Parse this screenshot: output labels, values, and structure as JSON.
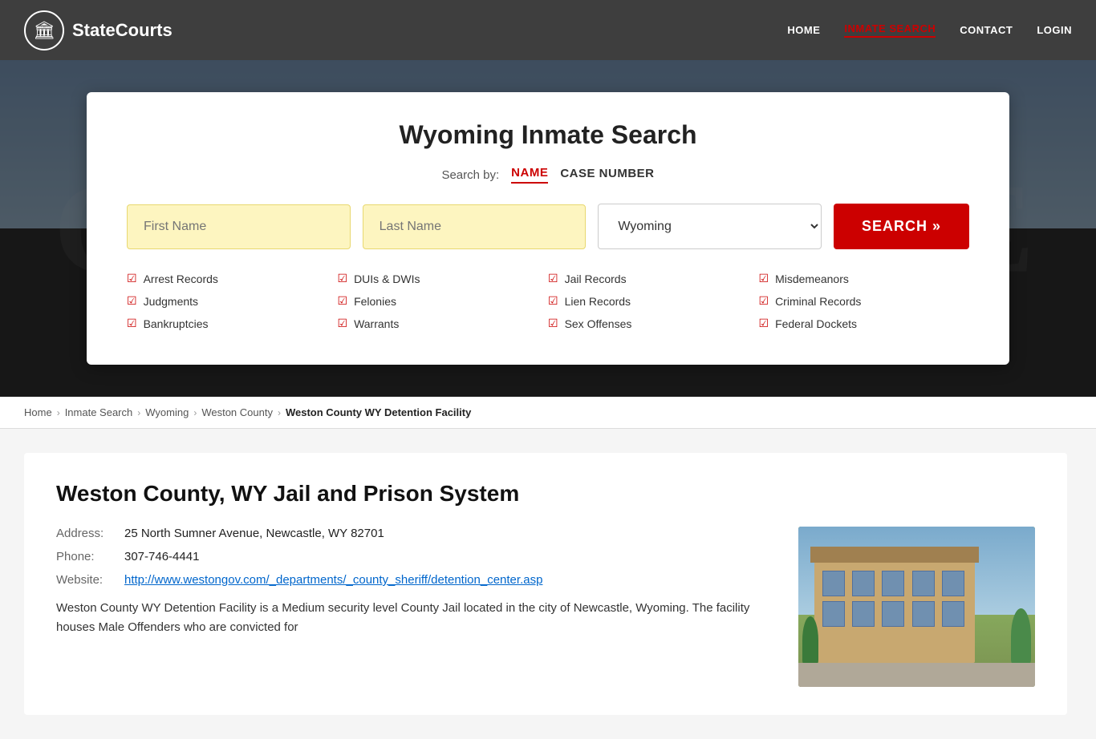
{
  "header": {
    "logo_text": "StateCourts",
    "logo_icon": "🏛",
    "nav": [
      {
        "label": "HOME",
        "active": false
      },
      {
        "label": "INMATE SEARCH",
        "active": true
      },
      {
        "label": "CONTACT",
        "active": false
      },
      {
        "label": "LOGIN",
        "active": false
      }
    ]
  },
  "hero": {
    "bg_text": "COURTHOUSE"
  },
  "search_card": {
    "title": "Wyoming Inmate Search",
    "search_by_label": "Search by:",
    "tab_name": "NAME",
    "tab_case": "CASE NUMBER",
    "first_name_placeholder": "First Name",
    "last_name_placeholder": "Last Name",
    "state_default": "Wyoming",
    "search_button": "SEARCH »",
    "features": [
      "Arrest Records",
      "Judgments",
      "Bankruptcies",
      "DUIs & DWIs",
      "Felonies",
      "Warrants",
      "Jail Records",
      "Lien Records",
      "Sex Offenses",
      "Misdemeanors",
      "Criminal Records",
      "Federal Dockets"
    ]
  },
  "breadcrumb": {
    "items": [
      {
        "label": "Home",
        "link": true
      },
      {
        "label": "Inmate Search",
        "link": true
      },
      {
        "label": "Wyoming",
        "link": true
      },
      {
        "label": "Weston County",
        "link": true
      },
      {
        "label": "Weston County WY Detention Facility",
        "link": false
      }
    ]
  },
  "facility": {
    "title": "Weston County, WY Jail and Prison System",
    "address_label": "Address:",
    "address_value": "25 North Sumner Avenue, Newcastle, WY 82701",
    "phone_label": "Phone:",
    "phone_value": "307-746-4441",
    "website_label": "Website:",
    "website_url": "http://www.westongov.com/_departments/_county_sheriff/detention_center.asp",
    "description": "Weston County WY Detention Facility is a Medium security level County Jail located in the city of Newcastle, Wyoming. The facility houses Male Offenders who are convicted for"
  }
}
